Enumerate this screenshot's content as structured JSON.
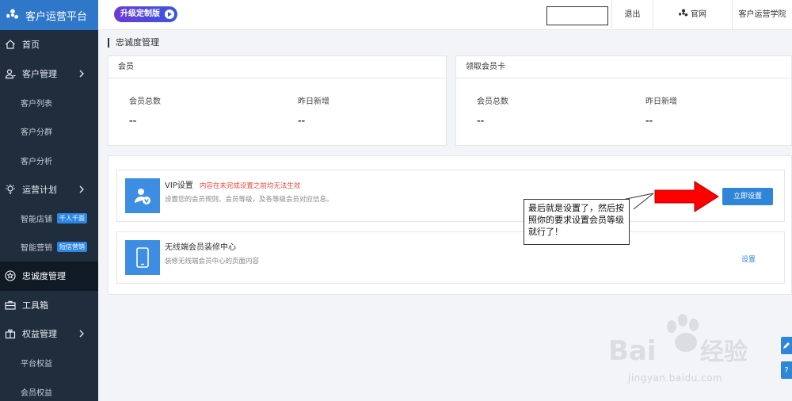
{
  "app": {
    "title": "客户运营平台",
    "upgrade_label": "升级定制版"
  },
  "topbar": {
    "logout": "退出",
    "site": "官网",
    "school": "客户运营学院"
  },
  "sidebar": {
    "items": [
      {
        "label": "首页",
        "icon": "home-icon"
      },
      {
        "label": "客户管理",
        "icon": "users-icon"
      },
      {
        "label": "客户列表"
      },
      {
        "label": "客户分群"
      },
      {
        "label": "客户分析"
      },
      {
        "label": "运营计划",
        "icon": "bulb-icon"
      },
      {
        "label": "智能店铺",
        "badge": "千人千面"
      },
      {
        "label": "智能营销",
        "badge": "短信营销"
      },
      {
        "label": "忠诚度管理",
        "icon": "star-icon"
      },
      {
        "label": "工具箱",
        "icon": "toolbox-icon"
      },
      {
        "label": "权益管理",
        "icon": "gift-icon"
      },
      {
        "label": "平台权益"
      },
      {
        "label": "会员权益"
      }
    ]
  },
  "breadcrumb": "忠诚度管理",
  "member_card": {
    "title": "会员",
    "stat1_label": "会员总数",
    "stat1_value": "--",
    "stat2_label": "昨日新增",
    "stat2_value": "--"
  },
  "claim_card": {
    "title": "领取会员卡",
    "stat1_label": "会员总数",
    "stat1_value": "--",
    "stat2_label": "昨日新增",
    "stat2_value": "--"
  },
  "vip": {
    "title": "VIP设置",
    "warning": "内容在未完成设置之前均无法生效",
    "desc": "设置您的会员规则、会员等级，及各等级会员对应信息。",
    "button": "立即设置"
  },
  "wireless": {
    "title": "无线端会员装修中心",
    "desc": "装修无线端会员中心的页面内容",
    "link": "设置"
  },
  "callout": {
    "text": "最后就是设置了，然后按照你的要求设置会员等级就行了！"
  },
  "watermark": {
    "url": "jingyan.baidu.com"
  },
  "colors": {
    "sidebar": "#1f2d3d",
    "brand": "#2f77c9",
    "primary": "#2f86d8",
    "warning": "#e84a3c",
    "arrow": "#ff0000"
  }
}
